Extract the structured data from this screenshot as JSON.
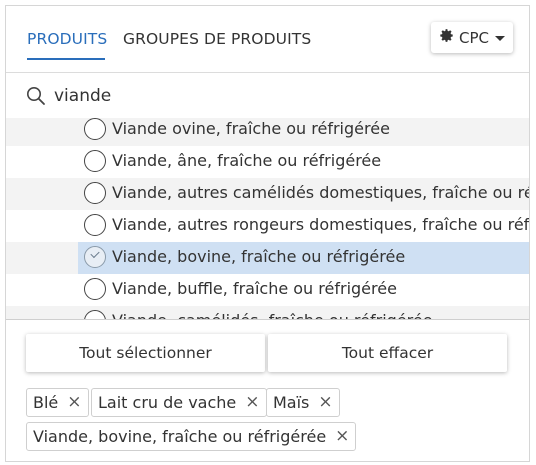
{
  "tabs": [
    {
      "label": "PRODUITS",
      "active": true
    },
    {
      "label": "GROUPES DE PRODUITS",
      "active": false
    }
  ],
  "classification": {
    "label": "CPC",
    "icon": "gear-icon"
  },
  "search": {
    "value": "viande",
    "placeholder": ""
  },
  "items": [
    {
      "label": "Viande ovine, fraîche ou réfrigérée",
      "selected": false
    },
    {
      "label": "Viande, âne, fraîche ou réfrigérée",
      "selected": false
    },
    {
      "label": "Viande, autres camélidés domestiques, fraîche ou réfrigérée",
      "selected": false
    },
    {
      "label": "Viande, autres rongeurs domestiques, fraîche ou réfrigérée",
      "selected": false
    },
    {
      "label": "Viande, bovine, fraîche ou réfrigérée",
      "selected": true
    },
    {
      "label": "Viande, buffle, fraîche ou réfrigérée",
      "selected": false
    },
    {
      "label": "Viande, camélidés, fraîche ou réfrigérée",
      "selected": false
    }
  ],
  "actions": {
    "select_all": "Tout sélectionner",
    "clear_all": "Tout effacer"
  },
  "chips": [
    {
      "label": "Blé"
    },
    {
      "label": "Lait cru de vache"
    },
    {
      "label": "Maïs"
    },
    {
      "label": "Viande, bovine, fraîche ou réfrigérée"
    }
  ],
  "colors": {
    "accent": "#2a6ebb",
    "selected_row": "#cfe0f3",
    "alt_row": "#f3f3f3"
  }
}
